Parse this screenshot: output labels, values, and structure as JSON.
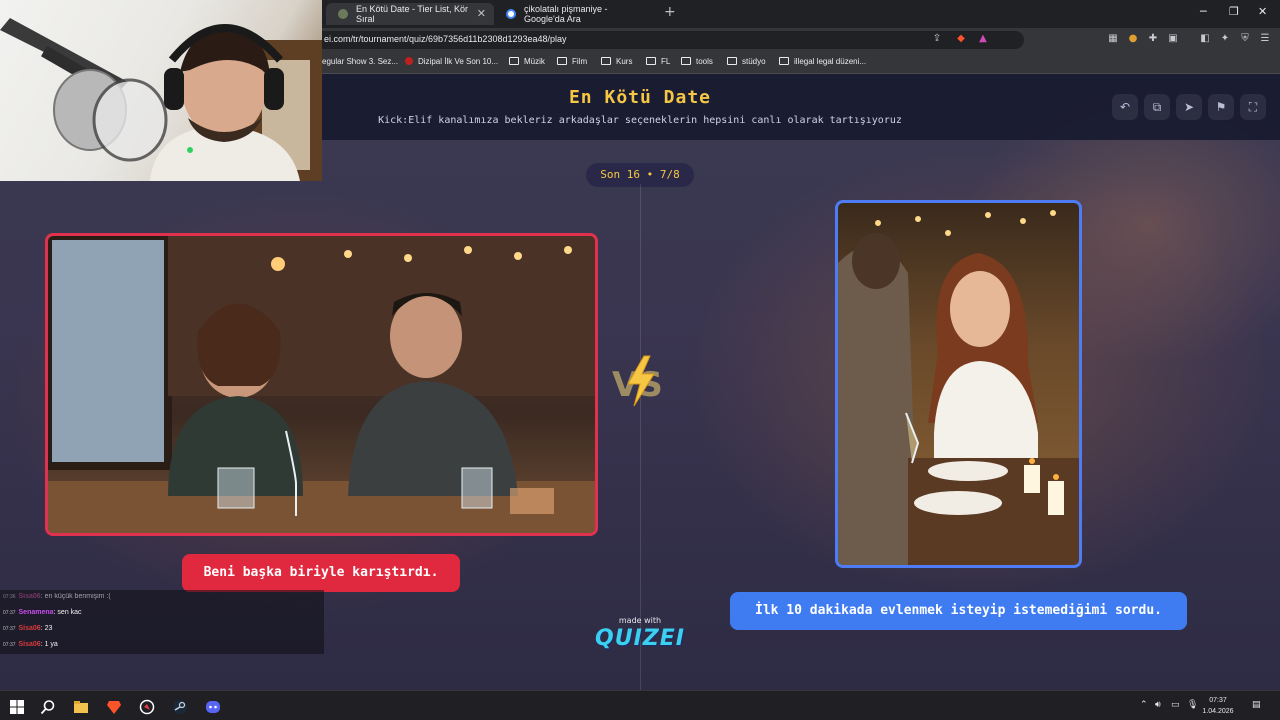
{
  "browser": {
    "tabs": [
      {
        "label": "En Kötü Date - Tier List, Kör Sıral",
        "active": true
      },
      {
        "label": "çikolatalı pişmaniye - Google'da Ara",
        "active": false
      }
    ],
    "url": "ei.com/tr/tournament/quiz/69b7356d11b2308d1293ea48/play",
    "bookmarks": [
      {
        "label": "egular Show 3. Sez...",
        "icon": "page-icon"
      },
      {
        "label": "Dizipal İlk Ve Son 10...",
        "icon": "site-icon"
      },
      {
        "label": "Müzik",
        "icon": "folder-icon"
      },
      {
        "label": "Film",
        "icon": "folder-icon"
      },
      {
        "label": "Kurs",
        "icon": "folder-icon"
      },
      {
        "label": "FL",
        "icon": "folder-icon"
      },
      {
        "label": "tools",
        "icon": "folder-icon"
      },
      {
        "label": "stüdyo",
        "icon": "folder-icon"
      },
      {
        "label": "illegal legal düzeni...",
        "icon": "folder-icon"
      }
    ]
  },
  "quiz": {
    "title": "En Kötü Date",
    "subtitle": "Kick:Elif kanalımıza bekleriz arkadaşlar seçeneklerin hepsini canlı olarak tartışıyoruz",
    "round": "Son 16 • 7/8",
    "left_choice": "Beni başka biriyle karıştırdı.",
    "right_choice": "İlk 10 dakikada evlenmek isteyip istemediğimi sordu.",
    "made_with": "made with",
    "brand": "QUIZEI",
    "colors": {
      "title": "#f6c744",
      "left_accent": "#e0283e",
      "right_accent": "#3f7cf2"
    }
  },
  "chat": [
    {
      "time": "07:36",
      "user": "Sisa06",
      "user_color": "#b04a8a",
      "message": ": en küçük benmişim :("
    },
    {
      "time": "07:37",
      "user": "Senamena",
      "user_color": "#c84cf0",
      "message": ": sen kac"
    },
    {
      "time": "07:37",
      "user": "Sisa06",
      "user_color": "#d83a3a",
      "message": ": 23"
    },
    {
      "time": "07:37",
      "user": "Sisa06",
      "user_color": "#d83a3a",
      "message": ": 1 ya"
    }
  ],
  "taskbar": {
    "time": "07:37",
    "date": "1.04.2026"
  }
}
